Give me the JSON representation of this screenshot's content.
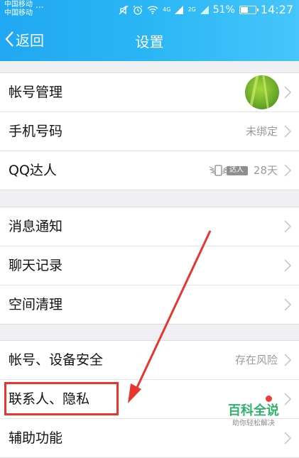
{
  "status_bar": {
    "carrier1": "中国移动",
    "carrier2": "中国移动",
    "dots": "...",
    "net1": "4G",
    "net2": "2G",
    "battery": "51%",
    "battery_level": 0.51,
    "time": "14:27"
  },
  "header": {
    "back_label": "返回",
    "title": "设置",
    "bg_color": "#2ab6f5"
  },
  "groups": [
    {
      "rows": [
        {
          "label": "帐号管理",
          "value": "",
          "accessory": "avatar"
        },
        {
          "label": "手机号码",
          "value": "未绑定"
        },
        {
          "label": "QQ达人",
          "value": "28天",
          "badge": "达人"
        }
      ]
    },
    {
      "rows": [
        {
          "label": "消息通知"
        },
        {
          "label": "聊天记录"
        },
        {
          "label": "空间清理"
        }
      ]
    },
    {
      "rows": [
        {
          "label": "帐号、设备安全",
          "value": "存在风险"
        },
        {
          "label": "联系人、隐私",
          "red_dot": true
        },
        {
          "label": "辅助功能"
        }
      ]
    }
  ],
  "annotation": {
    "color": "#e8362f"
  },
  "watermark": {
    "main": "百科全说",
    "sub": "助你轻松解决"
  }
}
